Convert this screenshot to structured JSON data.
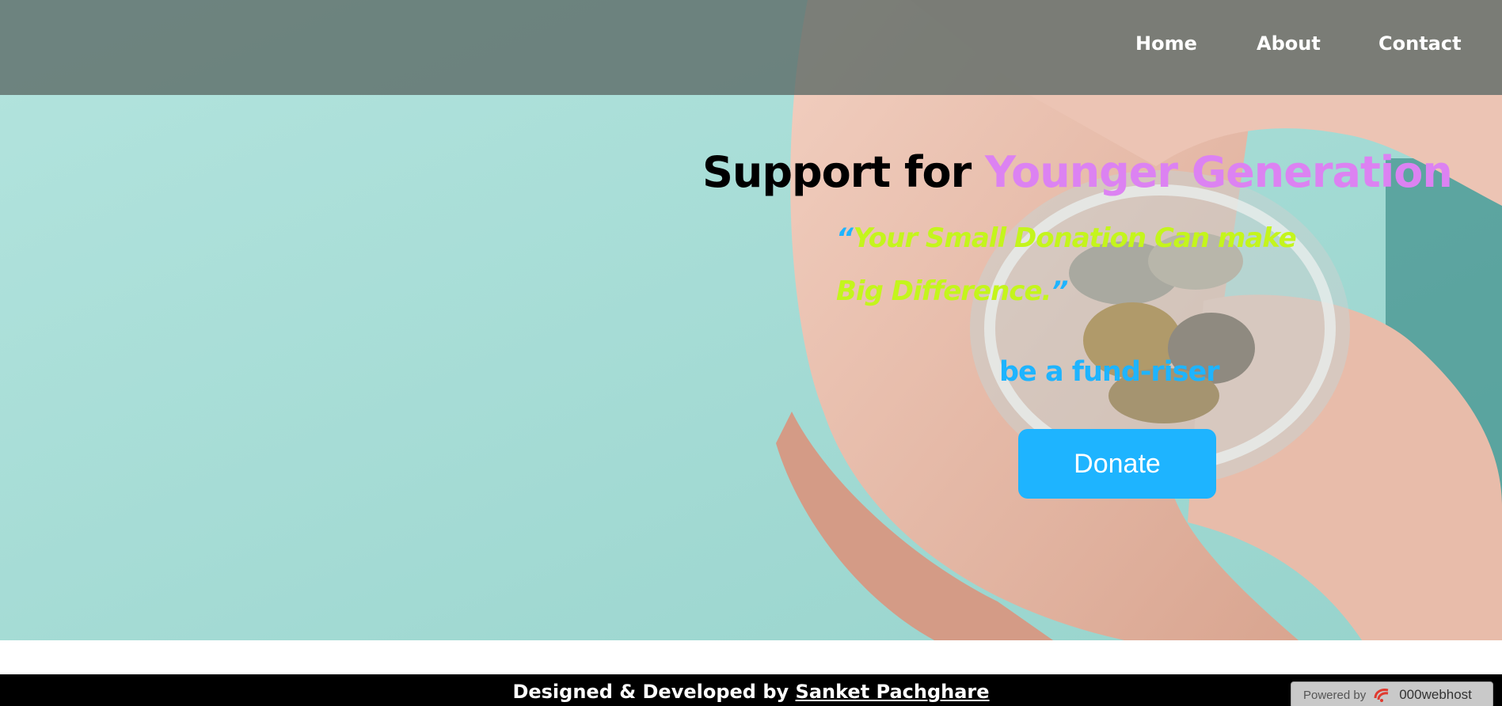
{
  "nav": {
    "items": [
      {
        "label": "Home"
      },
      {
        "label": "About"
      },
      {
        "label": "Contact"
      }
    ]
  },
  "hero": {
    "headline_prefix": "Support for ",
    "headline_accent": "Younger Generation",
    "quote_open": "“",
    "quote_text": "Your Small Donation Can make Big Difference.",
    "quote_close": "”",
    "tagline": "be a fund-riser",
    "donate_label": "Donate"
  },
  "footer": {
    "credit_prefix": "Designed & Developed by ",
    "author": "Sanket Pachghare"
  },
  "badge": {
    "powered_by": "Powered by",
    "brand": "000webhost"
  },
  "colors": {
    "accent_purple": "#dc82f2",
    "quote_lime": "#c4f51c",
    "accent_blue": "#1eb4ff",
    "hero_teal": "#a9dcd6"
  }
}
